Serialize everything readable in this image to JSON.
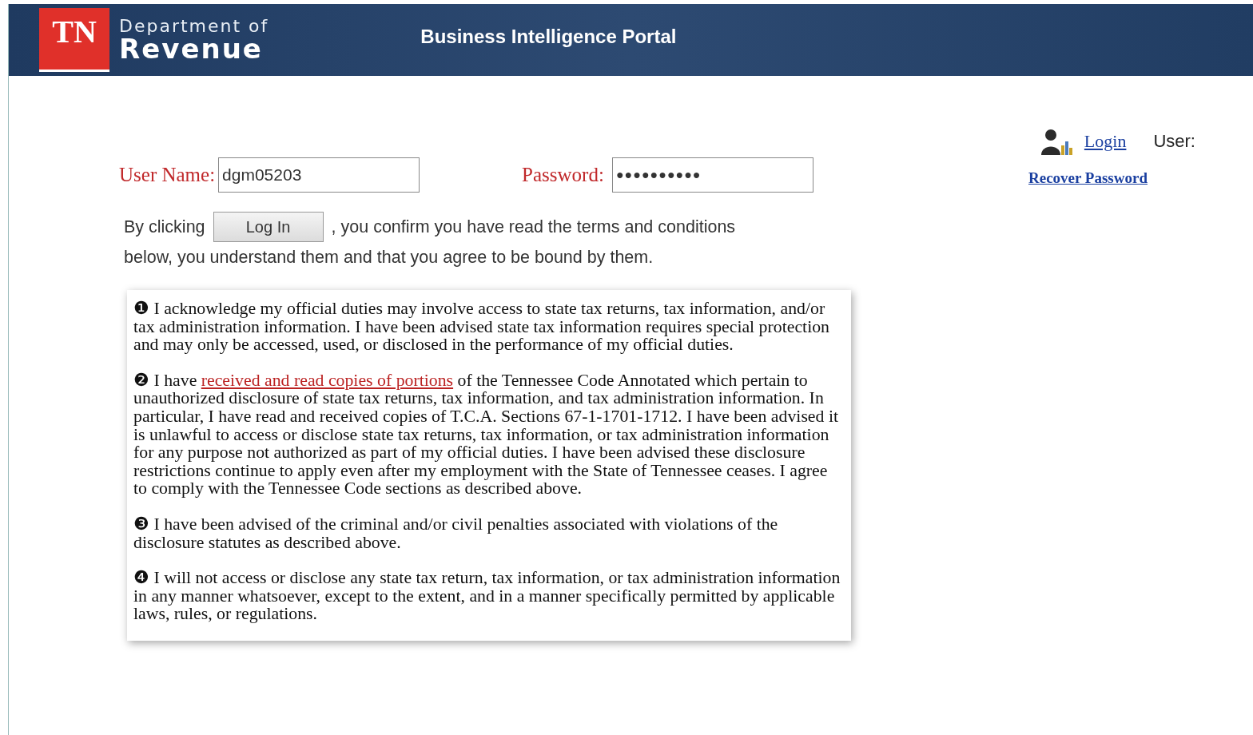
{
  "header": {
    "logo_mark": "TN",
    "logo_line1": "Department of",
    "logo_line2": "Revenue",
    "title": "Business Intelligence Portal"
  },
  "account": {
    "login_link": "Login",
    "user_label": "User:",
    "recover_link": "Recover Password"
  },
  "login_form": {
    "username_label": "User Name:",
    "username_value": "dgm05203",
    "password_label": "Password:",
    "password_value": "●●●●●●●●●●"
  },
  "consent": {
    "before": "By clicking",
    "button": "Log In",
    "after": ", you confirm you have read the terms and conditions",
    "after_line2": "below, you understand them and that you agree to be bound by them."
  },
  "terms": [
    {
      "marker": "❶",
      "before": "I acknowledge my official duties may involve access to state tax returns, tax information, and/or tax administration information. I have been advised state tax information requires special protection and may only be accessed, used, or disclosed in the performance of my official duties."
    },
    {
      "marker": "❷",
      "before": "I have",
      "link": "received and read copies of portions",
      "after": "of the Tennessee Code Annotated which pertain to unauthorized disclosure of state tax returns, tax information, and tax administration information. In particular, I have read and received copies of T.C.A. Sections 67-1-1701-1712. I have been advised it is unlawful to access or disclose state tax returns, tax information, or tax administration information for any purpose not authorized as part of my official duties. I have been advised these disclosure restrictions continue to apply even after my employment with the State of Tennessee ceases. I agree to comply with the Tennessee Code sections as described above."
    },
    {
      "marker": "❸",
      "before": "I have been advised of the criminal and/or civil penalties associated with violations of the disclosure statutes as described above."
    },
    {
      "marker": "❹",
      "before": "I will not access or disclose any state tax return, tax information, or tax administration information in any manner whatsoever, except to the extent, and in a manner specifically permitted by applicable laws, rules, or regulations."
    }
  ]
}
